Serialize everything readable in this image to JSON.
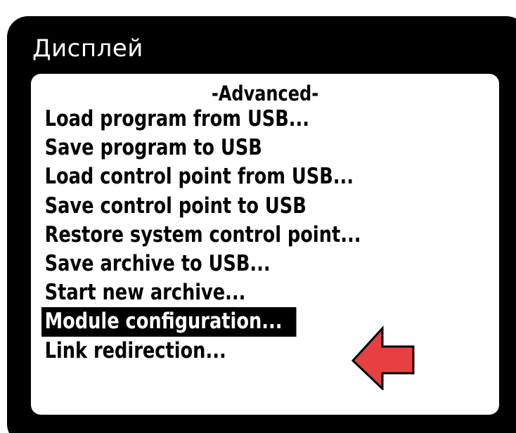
{
  "device": {
    "title": "Дисплей"
  },
  "menu": {
    "heading": "-Advanced-",
    "items": [
      {
        "label": "Load program from USB..."
      },
      {
        "label": "Save program to USB"
      },
      {
        "label": "Load control point from USB..."
      },
      {
        "label": "Save control point to USB"
      },
      {
        "label": "Restore system control point..."
      },
      {
        "label": "Save archive to USB..."
      },
      {
        "label": "Start new archive..."
      },
      {
        "label": "Module configuration..."
      },
      {
        "label": "Link redirection..."
      }
    ],
    "selected_label": "Module configuration..."
  },
  "pointer": {
    "icon": "left-arrow-icon",
    "color": "#e84040"
  }
}
